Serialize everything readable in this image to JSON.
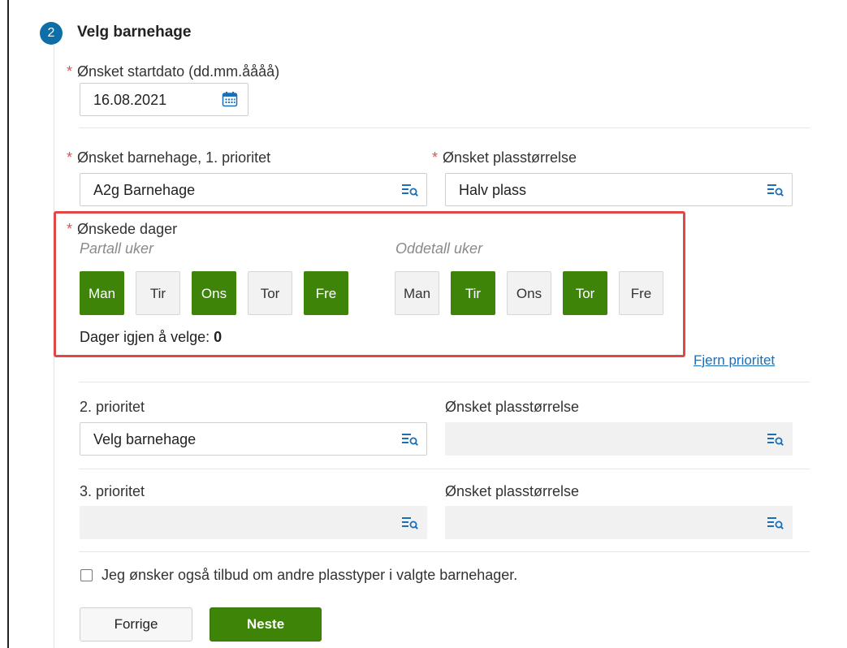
{
  "step": {
    "number": "2",
    "title": "Velg barnehage"
  },
  "start_date": {
    "label": "Ønsket startdato (dd.mm.åååå)",
    "value": "16.08.2021",
    "icon": "calendar-icon"
  },
  "priority1": {
    "label": "Ønsket barnehage, 1. prioritet",
    "value": "A2g Barnehage",
    "size_label": "Ønsket plasstørrelse",
    "size_value": "Halv plass"
  },
  "days": {
    "label": "Ønskede dager",
    "even_label": "Partall uker",
    "odd_label": "Oddetall uker",
    "even": [
      {
        "label": "Man",
        "selected": true
      },
      {
        "label": "Tir",
        "selected": false
      },
      {
        "label": "Ons",
        "selected": true
      },
      {
        "label": "Tor",
        "selected": false
      },
      {
        "label": "Fre",
        "selected": true
      }
    ],
    "odd": [
      {
        "label": "Man",
        "selected": false
      },
      {
        "label": "Tir",
        "selected": true
      },
      {
        "label": "Ons",
        "selected": false
      },
      {
        "label": "Tor",
        "selected": true
      },
      {
        "label": "Fre",
        "selected": false
      }
    ],
    "remaining_label": "Dager igjen å velge:",
    "remaining_value": "0"
  },
  "remove_priority_link": "Fjern prioritet",
  "priority2": {
    "label": "2. prioritet",
    "value": "Velg barnehage",
    "size_label": "Ønsket plasstørrelse"
  },
  "priority3": {
    "label": "3. prioritet",
    "size_label": "Ønsket plasstørrelse"
  },
  "other_types_checkbox": {
    "label": "Jeg ønsker også tilbud om andre plasstyper i valgte barnehager.",
    "checked": false
  },
  "buttons": {
    "previous": "Forrige",
    "next": "Neste"
  },
  "colors": {
    "accent_green": "#3d8408",
    "step_blue": "#0d6ea8",
    "required_red": "#d9534f",
    "highlight_red": "#e04848",
    "link_blue": "#1a6fb8"
  }
}
